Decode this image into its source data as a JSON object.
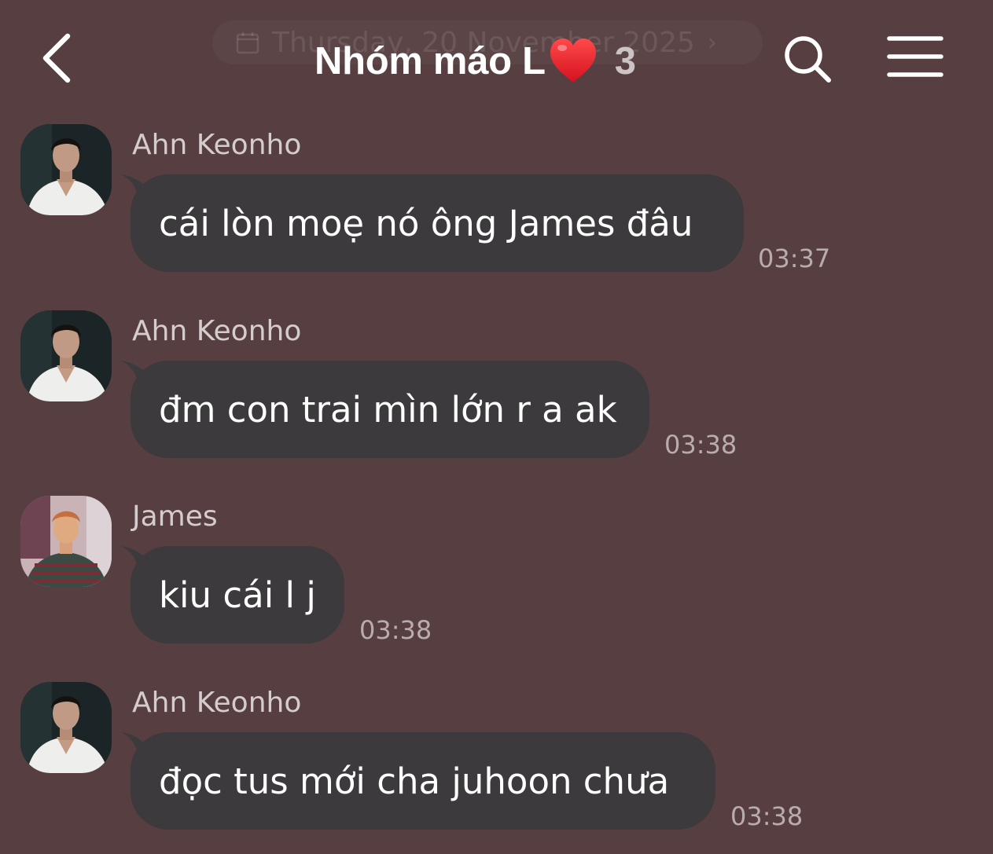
{
  "header": {
    "date_pill": "Thursday, 20 November 2025",
    "title": "Nhóm máo L",
    "member_count": "3",
    "back_icon": "chevron-left-icon",
    "search_icon": "search-icon",
    "menu_icon": "menu-icon"
  },
  "colors": {
    "background": "#573f41",
    "bubble": "#3c3a3c",
    "sender_text": "#d5cccd",
    "time_text": "#b8acad",
    "heart": "#e8202b"
  },
  "messages": [
    {
      "sender": "Ahn Keonho",
      "text": "cái lòn moẹ nó ông James đâu",
      "time": "03:37"
    },
    {
      "sender": "Ahn Keonho",
      "text": "đm con trai mìn lớn r a ak",
      "time": "03:38"
    },
    {
      "sender": "James",
      "text": "kiu cái l j",
      "time": "03:38"
    },
    {
      "sender": "Ahn Keonho",
      "text": "đọc tus mới cha juhoon chưa",
      "time": "03:38"
    }
  ]
}
